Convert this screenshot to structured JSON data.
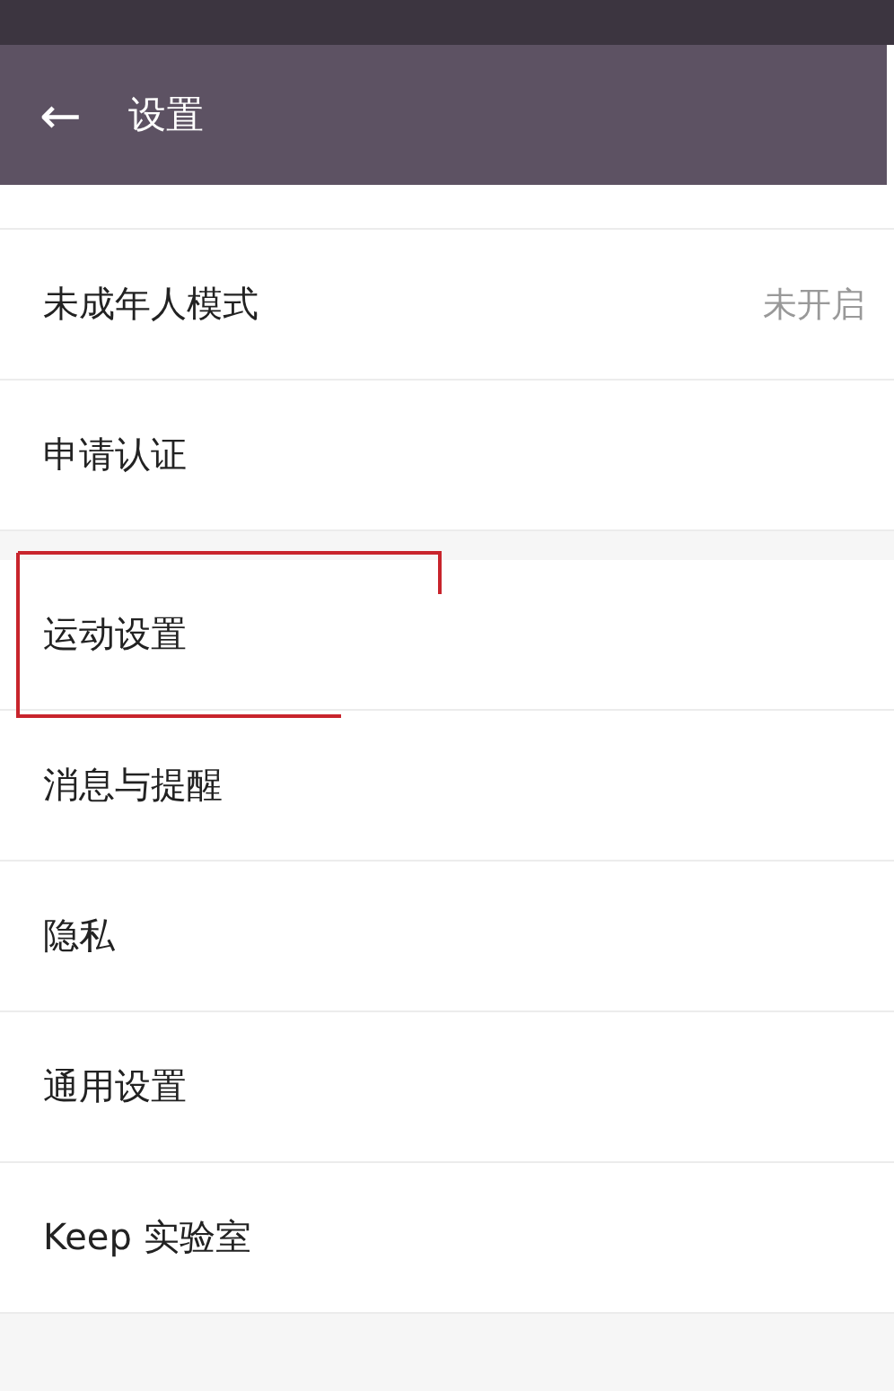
{
  "app_bar": {
    "back_icon": "←",
    "title": "设置"
  },
  "sections": [
    {
      "items": [
        {
          "label": "未成年人模式",
          "value": "未开启",
          "highlighted": false
        },
        {
          "label": "申请认证",
          "highlighted": false
        }
      ]
    },
    {
      "items": [
        {
          "label": "运动设置",
          "highlighted": true
        },
        {
          "label": "消息与提醒",
          "highlighted": false
        },
        {
          "label": "隐私",
          "highlighted": false
        },
        {
          "label": "通用设置",
          "highlighted": false
        },
        {
          "label": "Keep 实验室",
          "highlighted": false
        }
      ]
    }
  ]
}
